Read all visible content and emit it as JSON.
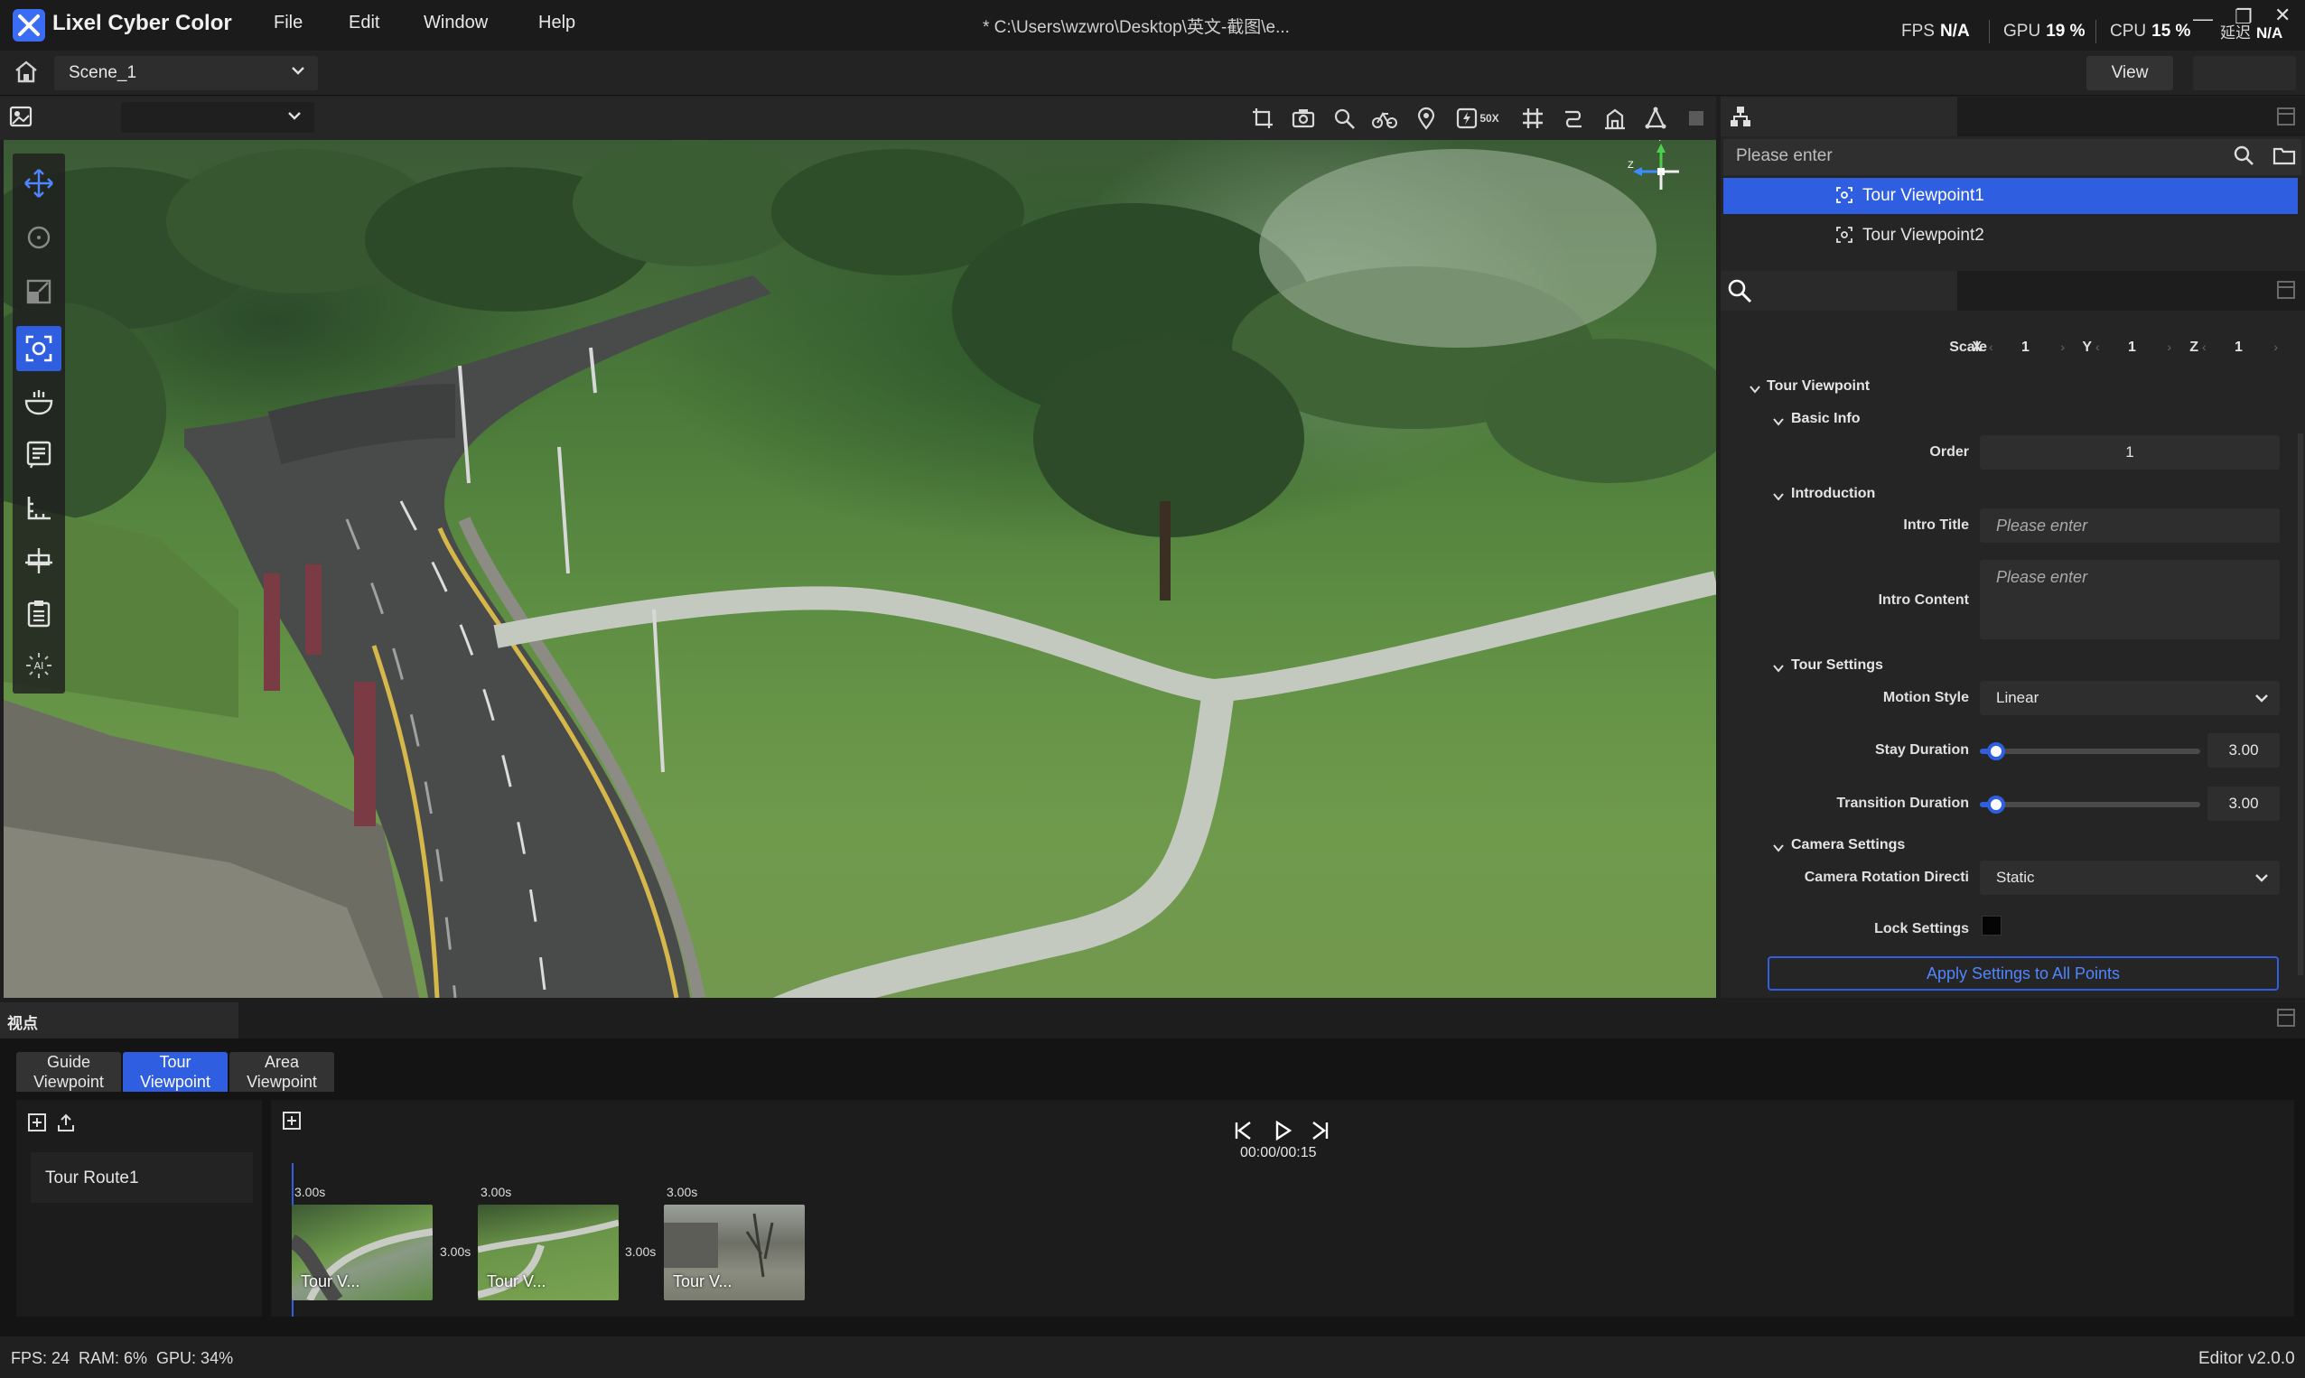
{
  "app": {
    "title": "Lixel Cyber Color",
    "menu": [
      "File",
      "Edit",
      "Window",
      "Help"
    ],
    "file_path": "* C:\\Users\\wzwro\\Desktop\\英文-截图\\e...",
    "stats": {
      "fps_label": "FPS",
      "fps_value": "N/A",
      "gpu_label": "GPU",
      "gpu_value": "19 %",
      "cpu_label": "CPU",
      "cpu_value": "15 %",
      "latency_label": "延迟",
      "latency_value": "N/A"
    }
  },
  "scene_bar": {
    "scene": "Scene_1",
    "view_button": "View"
  },
  "viewport": {
    "toolbar_icons": [
      "crop-icon",
      "camera-icon",
      "search-area-icon",
      "bike-icon",
      "location-pin-icon",
      "speed-icon",
      "grid-icon",
      "route-icon",
      "building-icon",
      "measure-icon",
      "layer-icon"
    ],
    "speed_badge": "50X",
    "tools": [
      "move-tool-icon",
      "rotate-tool-icon",
      "scale-tool-icon",
      "focus-tool-icon",
      "bowl-tool-icon",
      "notes-tool-icon",
      "measure-tool-icon",
      "align-tool-icon",
      "clipboard-tool-icon",
      "ai-tool-icon"
    ],
    "active_tool_index": 3,
    "gizmo": {
      "y": "Y",
      "z": "Z"
    }
  },
  "outline": {
    "search_placeholder": "Please enter",
    "items": [
      {
        "label": "Tour Viewpoint1",
        "selected": true
      },
      {
        "label": "Tour Viewpoint2",
        "selected": false
      }
    ]
  },
  "properties": {
    "scale": {
      "label": "Scale",
      "x_label": "X",
      "x": "1",
      "y_label": "Y",
      "y": "1",
      "z_label": "Z",
      "z": "1"
    },
    "section": "Tour Viewpoint",
    "basic_info": {
      "header": "Basic Info",
      "order_label": "Order",
      "order": "1"
    },
    "introduction": {
      "header": "Introduction",
      "title_label": "Intro Title",
      "title_placeholder": "Please enter",
      "content_label": "Intro Content",
      "content_placeholder": "Please enter"
    },
    "tour_settings": {
      "header": "Tour Settings",
      "motion_label": "Motion Style",
      "motion_value": "Linear",
      "stay_label": "Stay Duration",
      "stay_value": "3.00",
      "stay_fraction": 0.04,
      "transition_label": "Transition Duration",
      "transition_value": "3.00",
      "transition_fraction": 0.04
    },
    "camera_settings": {
      "header": "Camera Settings",
      "rotation_label": "Camera Rotation Directi",
      "rotation_value": "Static",
      "lock_label": "Lock Settings",
      "lock_checked": false
    },
    "apply_button": "Apply Settings to All Points"
  },
  "bottom": {
    "title": "视点",
    "tabs": [
      {
        "line1": "Guide",
        "line2": "Viewpoint",
        "active": false
      },
      {
        "line1": "Tour",
        "line2": "Viewpoint",
        "active": true
      },
      {
        "line1": "Area",
        "line2": "Viewpoint",
        "active": false
      }
    ],
    "route": "Tour Route1",
    "time": "00:00/00:15",
    "clips": [
      {
        "label": "Tour V...",
        "duration": "3.00s"
      },
      {
        "label": "Tour V...",
        "duration": "3.00s"
      },
      {
        "label": "Tour V...",
        "duration": "3.00s"
      }
    ],
    "gaps": [
      "3.00s",
      "3.00s"
    ]
  },
  "status": {
    "left": "FPS: 24  RAM: 6%  GPU: 34%",
    "right": "Editor v2.0.0"
  },
  "colors": {
    "accent": "#2f5fe0",
    "background": "#1e1e1e"
  }
}
